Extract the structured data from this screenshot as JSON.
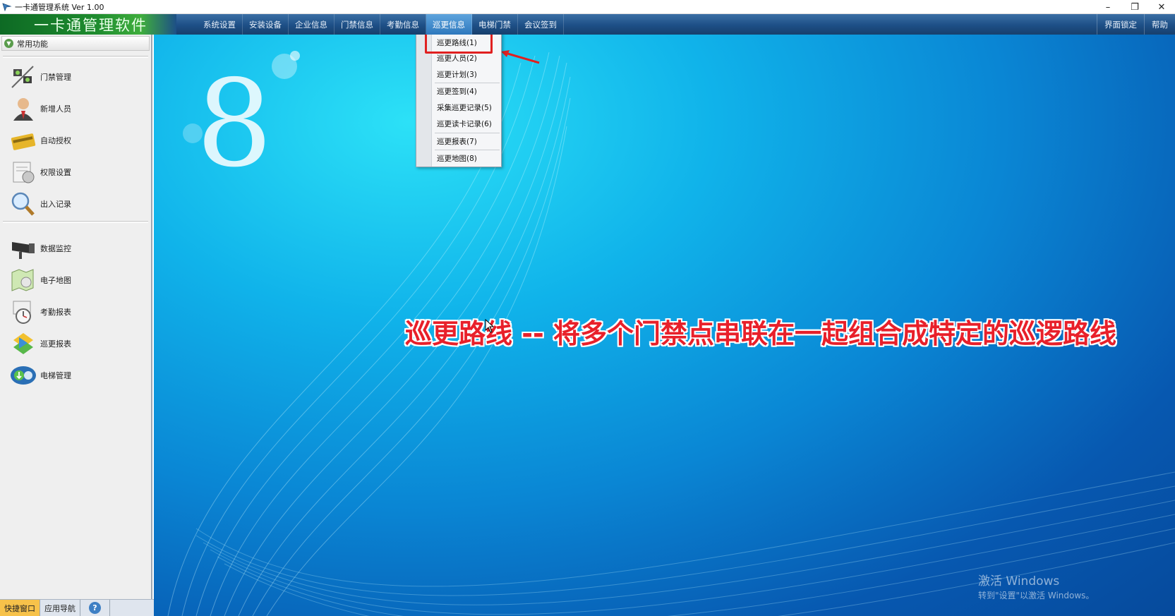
{
  "window": {
    "title": "一卡通管理系统  Ver 1.00"
  },
  "brand": "一卡通管理软件",
  "menus": [
    {
      "label": "系统设置"
    },
    {
      "label": "安装设备"
    },
    {
      "label": "企业信息"
    },
    {
      "label": "门禁信息"
    },
    {
      "label": "考勤信息"
    },
    {
      "label": "巡更信息"
    },
    {
      "label": "电梯门禁"
    },
    {
      "label": "会议签到"
    }
  ],
  "menus_right": [
    {
      "label": "界面锁定"
    },
    {
      "label": "帮助"
    }
  ],
  "sidebar": {
    "header": "常用功能",
    "items": [
      {
        "label": "门禁管理",
        "icon": "door-control-icon"
      },
      {
        "label": "新增人员",
        "icon": "person-icon"
      },
      {
        "label": "自动授权",
        "icon": "card-icon"
      },
      {
        "label": "权限设置",
        "icon": "permission-icon"
      },
      {
        "label": "出入记录",
        "icon": "magnifier-icon"
      },
      {
        "label": "数据监控",
        "icon": "camera-icon"
      },
      {
        "label": "电子地图",
        "icon": "map-icon"
      },
      {
        "label": "考勤报表",
        "icon": "clock-icon"
      },
      {
        "label": "巡更报表",
        "icon": "patrol-report-icon"
      },
      {
        "label": "电梯管理",
        "icon": "elevator-icon"
      }
    ]
  },
  "bottom_tabs": [
    {
      "label": "快捷窗口"
    },
    {
      "label": "应用导航"
    }
  ],
  "dropdown": {
    "items": [
      {
        "label": "巡更路线(1)"
      },
      {
        "label": "巡更人员(2)"
      },
      {
        "label": "巡更计划(3)"
      },
      {
        "label": "巡更签到(4)"
      },
      {
        "label": "采集巡更记录(5)"
      },
      {
        "label": "巡更读卡记录(6)"
      },
      {
        "label": "巡更报表(7)"
      },
      {
        "label": "巡更地图(8)"
      }
    ]
  },
  "annotation": "巡更路线 -- 将多个门禁点串联在一起组合成特定的巡逻路线",
  "watermark": {
    "line1": "激活 Windows",
    "line2": "转到\"设置\"以激活 Windows。"
  },
  "colors": {
    "accent": "#2e78bd",
    "annotation": "#e8202a",
    "brand_green": "#1f8c2f"
  }
}
